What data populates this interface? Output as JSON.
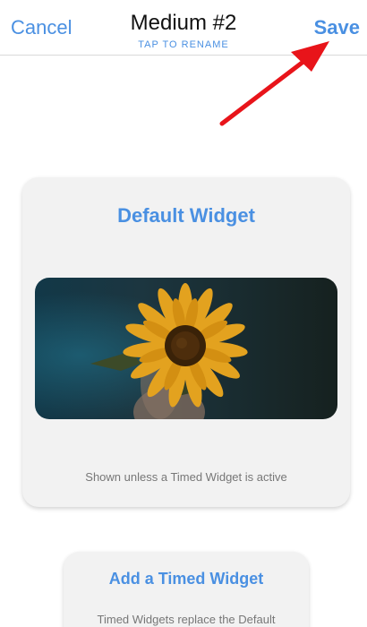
{
  "nav": {
    "cancel_label": "Cancel",
    "title": "Medium #2",
    "rename_hint": "TAP TO RENAME",
    "save_label": "Save"
  },
  "default_widget": {
    "title": "Default Widget",
    "caption": "Shown unless a Timed Widget is active"
  },
  "timed_widget": {
    "title": "Add a Timed Widget",
    "caption": "Timed Widgets replace the Default"
  },
  "colors": {
    "accent": "#4a90e2",
    "annotation_arrow": "#e8141a"
  }
}
